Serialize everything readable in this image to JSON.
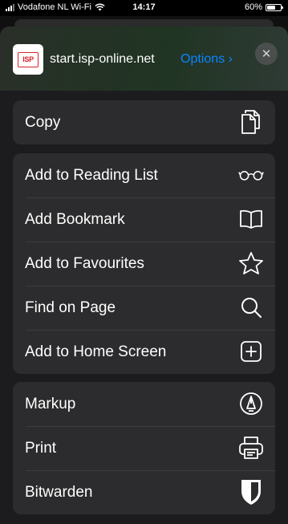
{
  "status_bar": {
    "carrier": "Vodafone NL Wi-Fi",
    "time": "14:17",
    "battery_percent": "60%",
    "battery_level": 0.6
  },
  "share_sheet": {
    "site_icon_text": "ISP",
    "url": "start.isp-online.net",
    "options_label": "Options ›",
    "close_icon": "close-icon",
    "accent_color": "#0a84ff"
  },
  "groups": [
    {
      "items": [
        {
          "label": "Copy",
          "icon": "copy-icon"
        }
      ]
    },
    {
      "items": [
        {
          "label": "Add to Reading List",
          "icon": "glasses-icon"
        },
        {
          "label": "Add Bookmark",
          "icon": "book-icon"
        },
        {
          "label": "Add to Favourites",
          "icon": "star-icon"
        },
        {
          "label": "Find on Page",
          "icon": "search-icon"
        },
        {
          "label": "Add to Home Screen",
          "icon": "plus-square-icon"
        }
      ]
    },
    {
      "items": [
        {
          "label": "Markup",
          "icon": "markup-pen-icon"
        },
        {
          "label": "Print",
          "icon": "printer-icon"
        },
        {
          "label": "Bitwarden",
          "icon": "bitwarden-shield-icon"
        }
      ]
    }
  ]
}
